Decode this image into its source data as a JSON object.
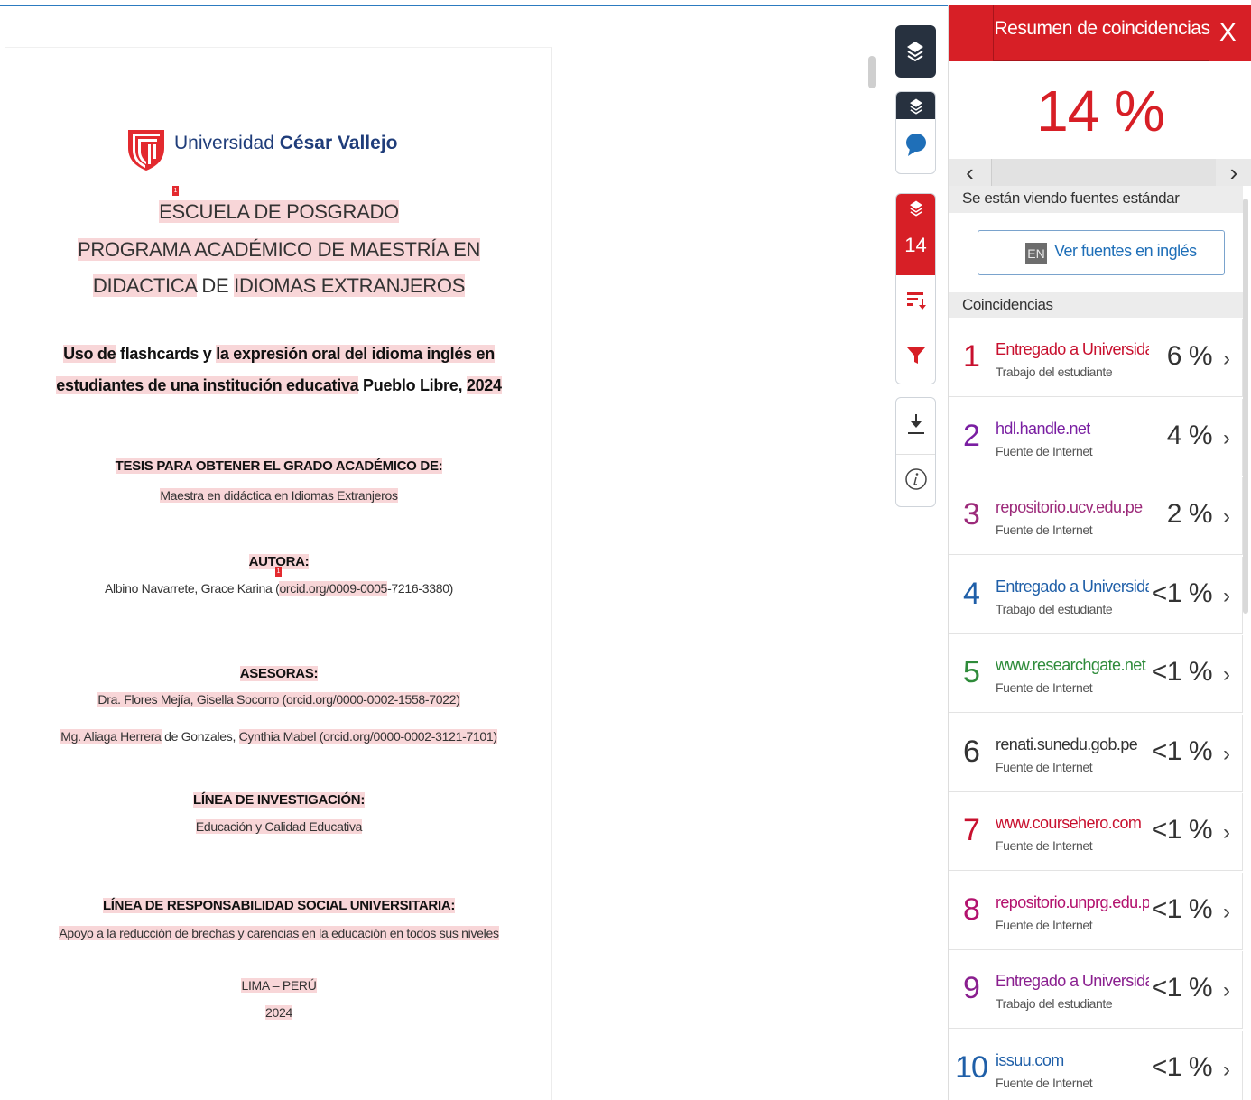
{
  "document": {
    "logo": {
      "name_regular": "Universidad",
      "name_bold": "César Vallejo"
    },
    "school": "ESCUELA DE POSGRADO",
    "program_line1": "PROGRAMA ACADÉMICO DE MAESTRÍA EN",
    "program_line2_a": "DIDACTICA",
    "program_line2_b": " DE ",
    "program_line2_c": "IDIOMAS EXTRANJEROS",
    "title_line1_a": "Uso de",
    "title_line1_b": " flashcards y ",
    "title_line1_c": "la expresión oral del idioma inglés en",
    "title_line2_a": "estudiantes de una institución educativa",
    "title_line2_b": " Pueblo Libre, ",
    "title_line2_c": "2024",
    "thesis_heading": "TESIS PARA OBTENER EL GRADO ACADÉMICO DE:",
    "degree": "Maestra en didáctica en Idiomas Extranjeros",
    "author_heading": "AUTORA:",
    "author_name": "Albino Navarrete, Grace Karina (",
    "author_orcid_a": "orcid.org/0009-0005",
    "author_orcid_b": "-7216-3380)",
    "advisors_heading": "ASESORAS:",
    "advisor1": "Dra. Flores Mejía, Gisella Socorro (orcid.org/0000-0002-1558-7022)",
    "advisor2_a": "Mg. Aliaga Herrera",
    "advisor2_b": " de Gonzales, ",
    "advisor2_c": "Cynthia Mabel (orcid.org/0000-0002-3121-7101)",
    "research_line_heading": "LÍNEA DE INVESTIGACIÓN:",
    "research_line": "Educación y Calidad Educativa",
    "rsu_heading": "LÍNEA DE RESPONSABILIDAD SOCIAL UNIVERSITARIA:",
    "rsu_line": "Apoyo a la reducción de brechas y carencias en la educación en todos sus niveles",
    "place": "LIMA – PERÚ",
    "year": "2024",
    "markers": [
      "1",
      "1"
    ]
  },
  "toolbar": {
    "match_count": "14",
    "icons": [
      "layers-icon",
      "layers-icon",
      "comment-icon",
      "layers-icon",
      "sort-icon",
      "filter-icon",
      "download-icon",
      "info-icon"
    ]
  },
  "panel": {
    "title": "Resumen de coincidencias",
    "close": "X",
    "overall_percent": "14 %",
    "prev": "‹",
    "next": "›",
    "sources_info": "Se están viendo fuentes estándar",
    "en_badge": "EN",
    "en_button": "Ver fuentes en inglés",
    "matches_heading": "Coincidencias",
    "matches": [
      {
        "num": "1",
        "source": "Entregado a Universida...",
        "type": "Trabajo del estudiante",
        "percent": "6 %",
        "color": "#c8102e"
      },
      {
        "num": "2",
        "source": "hdl.handle.net",
        "type": "Fuente de Internet",
        "percent": "4 %",
        "color": "#7a1fa2"
      },
      {
        "num": "3",
        "source": "repositorio.ucv.edu.pe",
        "type": "Fuente de Internet",
        "percent": "2 %",
        "color": "#9c2a7a"
      },
      {
        "num": "4",
        "source": "Entregado a Universida...",
        "type": "Trabajo del estudiante",
        "percent": "<1 %",
        "color": "#1f5fa8"
      },
      {
        "num": "5",
        "source": "www.researchgate.net",
        "type": "Fuente de Internet",
        "percent": "<1 %",
        "color": "#2e8b3a"
      },
      {
        "num": "6",
        "source": "renati.sunedu.gob.pe",
        "type": "Fuente de Internet",
        "percent": "<1 %",
        "color": "#333333"
      },
      {
        "num": "7",
        "source": "www.coursehero.com",
        "type": "Fuente de Internet",
        "percent": "<1 %",
        "color": "#c8102e"
      },
      {
        "num": "8",
        "source": "repositorio.unprg.edu.pe",
        "type": "Fuente de Internet",
        "percent": "<1 %",
        "color": "#b3126e"
      },
      {
        "num": "9",
        "source": "Entregado a Universida...",
        "type": "Trabajo del estudiante",
        "percent": "<1 %",
        "color": "#8a1f8f"
      },
      {
        "num": "10",
        "source": "issuu.com",
        "type": "Fuente de Internet",
        "percent": "<1 %",
        "color": "#1f5fa8"
      }
    ]
  },
  "colors": {
    "accent": "#d71f26",
    "highlight": "#f8d6d8",
    "link": "#1f6fb8",
    "toolbar_dark": "#27313f"
  }
}
